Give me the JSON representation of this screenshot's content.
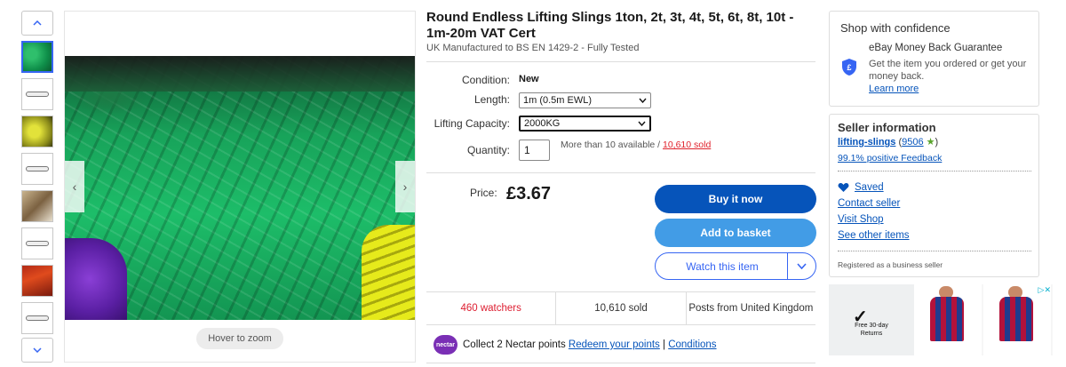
{
  "listing": {
    "title": "Round Endless Lifting Slings 1ton, 2t, 3t, 4t, 5t, 6t, 8t, 10t - 1m-20m VAT Cert",
    "subtitle": "UK Manufactured to BS EN 1429-2 - Fully Tested",
    "condition_label": "Condition:",
    "condition_value": "New",
    "length_label": "Length:",
    "length_value": "1m (0.5m EWL)",
    "capacity_label": "Lifting Capacity:",
    "capacity_value": "2000KG",
    "quantity_label": "Quantity:",
    "quantity_value": "1",
    "availability_text": "More than 10 available / ",
    "sold_link": "10,610 sold",
    "price_label": "Price:",
    "price": "£3.67",
    "buy_now": "Buy it now",
    "add_to_basket": "Add to basket",
    "watch_item": "Watch this item",
    "stats": {
      "watchers": "460 watchers",
      "sold": "10,610 sold",
      "posts_from": "Posts from United Kingdom"
    },
    "nectar": {
      "logo": "nectar",
      "text": "Collect 2 Nectar points ",
      "redeem": "Redeem your points",
      "separator": " | ",
      "conditions": "Conditions"
    }
  },
  "gallery": {
    "zoom_hint": "Hover to zoom",
    "thumbnail_count": 8,
    "active_index": 0
  },
  "confidence": {
    "title": "Shop with confidence",
    "guarantee_title": "eBay Money Back Guarantee",
    "guarantee_desc": "Get the item you ordered or get your money back.",
    "learn_more": "Learn more"
  },
  "seller": {
    "title": "Seller information",
    "name": "lifting-slings",
    "score": "9506",
    "feedback": "99.1% positive Feedback",
    "saved": "Saved",
    "contact": "Contact seller",
    "visit_shop": "Visit Shop",
    "other_items": "See other items",
    "registered": "Registered as a business seller"
  },
  "ad": {
    "line1": "Free 30-day",
    "line2": "Returns",
    "adchoices": "▷✕"
  },
  "colors": {
    "primary_blue": "#0654ba",
    "link_blue": "#3665f3",
    "basket_blue": "#429ce6",
    "alert_red": "#dd1e31",
    "nectar_purple": "#7a2fb5",
    "star_green": "#58a32a"
  }
}
